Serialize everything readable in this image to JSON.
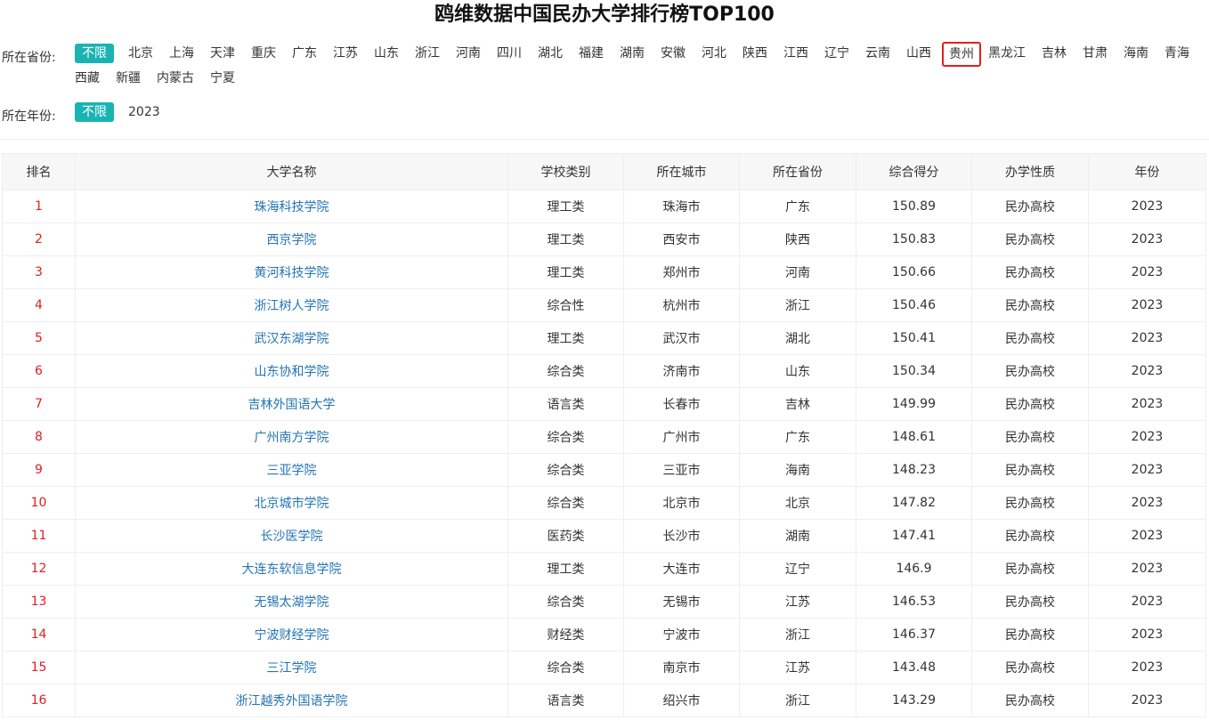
{
  "title": "鸥维数据中国民办大学排行榜TOP100",
  "filters": {
    "province": {
      "label": "所在省份:",
      "options": [
        "不限",
        "北京",
        "上海",
        "天津",
        "重庆",
        "广东",
        "江苏",
        "山东",
        "浙江",
        "河南",
        "四川",
        "湖北",
        "福建",
        "湖南",
        "安徽",
        "河北",
        "陕西",
        "江西",
        "辽宁",
        "云南",
        "山西",
        "贵州",
        "黑龙江",
        "吉林",
        "甘肃",
        "海南",
        "青海",
        "西藏",
        "新疆",
        "内蒙古",
        "宁夏"
      ],
      "selected": "不限",
      "highlighted": "贵州"
    },
    "year": {
      "label": "所在年份:",
      "options": [
        "不限",
        "2023"
      ],
      "selected": "不限"
    }
  },
  "table": {
    "headers": [
      "排名",
      "大学名称",
      "学校类别",
      "所在城市",
      "所在省份",
      "综合得分",
      "办学性质",
      "年份"
    ],
    "rows": [
      [
        "1",
        "珠海科技学院",
        "理工类",
        "珠海市",
        "广东",
        "150.89",
        "民办高校",
        "2023"
      ],
      [
        "2",
        "西京学院",
        "理工类",
        "西安市",
        "陕西",
        "150.83",
        "民办高校",
        "2023"
      ],
      [
        "3",
        "黄河科技学院",
        "理工类",
        "郑州市",
        "河南",
        "150.66",
        "民办高校",
        "2023"
      ],
      [
        "4",
        "浙江树人学院",
        "综合性",
        "杭州市",
        "浙江",
        "150.46",
        "民办高校",
        "2023"
      ],
      [
        "5",
        "武汉东湖学院",
        "理工类",
        "武汉市",
        "湖北",
        "150.41",
        "民办高校",
        "2023"
      ],
      [
        "6",
        "山东协和学院",
        "综合类",
        "济南市",
        "山东",
        "150.34",
        "民办高校",
        "2023"
      ],
      [
        "7",
        "吉林外国语大学",
        "语言类",
        "长春市",
        "吉林",
        "149.99",
        "民办高校",
        "2023"
      ],
      [
        "8",
        "广州南方学院",
        "综合类",
        "广州市",
        "广东",
        "148.61",
        "民办高校",
        "2023"
      ],
      [
        "9",
        "三亚学院",
        "综合类",
        "三亚市",
        "海南",
        "148.23",
        "民办高校",
        "2023"
      ],
      [
        "10",
        "北京城市学院",
        "综合类",
        "北京市",
        "北京",
        "147.82",
        "民办高校",
        "2023"
      ],
      [
        "11",
        "长沙医学院",
        "医药类",
        "长沙市",
        "湖南",
        "147.41",
        "民办高校",
        "2023"
      ],
      [
        "12",
        "大连东软信息学院",
        "理工类",
        "大连市",
        "辽宁",
        "146.9",
        "民办高校",
        "2023"
      ],
      [
        "13",
        "无锡太湖学院",
        "综合类",
        "无锡市",
        "江苏",
        "146.53",
        "民办高校",
        "2023"
      ],
      [
        "14",
        "宁波财经学院",
        "财经类",
        "宁波市",
        "浙江",
        "146.37",
        "民办高校",
        "2023"
      ],
      [
        "15",
        "三江学院",
        "综合类",
        "南京市",
        "江苏",
        "143.48",
        "民办高校",
        "2023"
      ],
      [
        "16",
        "浙江越秀外国语学院",
        "语言类",
        "绍兴市",
        "浙江",
        "143.29",
        "民办高校",
        "2023"
      ]
    ]
  },
  "colors": {
    "accent": "#1ab3b3",
    "rank": "#e02020",
    "link": "#2474b5",
    "highlight_border": "#e02020"
  }
}
